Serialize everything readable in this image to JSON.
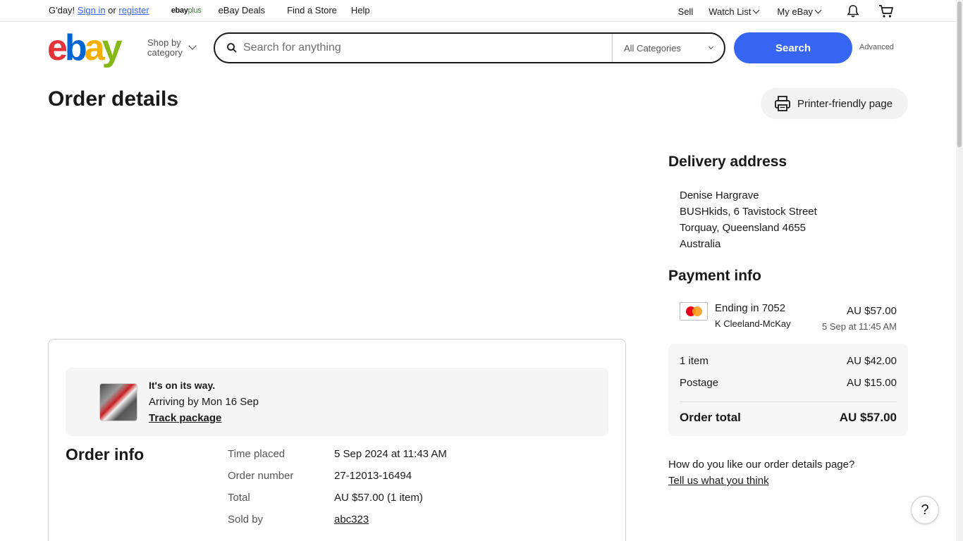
{
  "topbar": {
    "greeting": "G'day!",
    "sign_in": "Sign in",
    "or": "or",
    "register": "register",
    "ebay_plus_a": "ebay",
    "ebay_plus_b": "plus",
    "deals": "eBay Deals",
    "find_store": "Find a Store",
    "help": "Help",
    "sell": "Sell",
    "watch_list": "Watch List",
    "my_ebay": "My eBay"
  },
  "header": {
    "logo": [
      "e",
      "b",
      "a",
      "y"
    ],
    "shop_by_1": "Shop by",
    "shop_by_2": "category",
    "search_placeholder": "Search for anything",
    "category": "All Categories",
    "search_button": "Search",
    "advanced": "Advanced"
  },
  "page": {
    "title": "Order details",
    "print_button": "Printer-friendly page"
  },
  "order": {
    "status_title": "It's on its way.",
    "arriving": "Arriving by Mon 16 Sep",
    "track": "Track package",
    "info_title": "Order info",
    "rows": [
      {
        "label": "Time placed",
        "value": "5 Sep 2024 at 11:43 AM"
      },
      {
        "label": "Order number",
        "value": "27-12013-16494"
      },
      {
        "label": "Total",
        "value": "AU $57.00 (1 item)"
      },
      {
        "label": "Sold by",
        "value": "abc323"
      }
    ]
  },
  "delivery": {
    "title": "Delivery address",
    "lines": [
      "Denise Hargrave",
      "BUSHkids, 6 Tavistock Street",
      "Torquay, Queensland 4655",
      "Australia"
    ]
  },
  "payment": {
    "title": "Payment info",
    "ending": "Ending in 7052",
    "name": "K Cleeland-McKay",
    "amount": "AU $57.00",
    "date": "5 Sep at 11:45 AM"
  },
  "summary": {
    "items_label": "1 item",
    "items_value": "AU $42.00",
    "postage_label": "Postage",
    "postage_value": "AU $15.00",
    "total_label": "Order total",
    "total_value": "AU $57.00"
  },
  "feedback": {
    "question": "How do you like our order details page?",
    "link": "Tell us what you think"
  },
  "help_glyph": "?",
  "colors": {
    "accent": "#3665f3",
    "logo_e": "#e53238",
    "logo_b": "#0064d2",
    "logo_a": "#f5af02",
    "logo_y": "#86b817"
  }
}
